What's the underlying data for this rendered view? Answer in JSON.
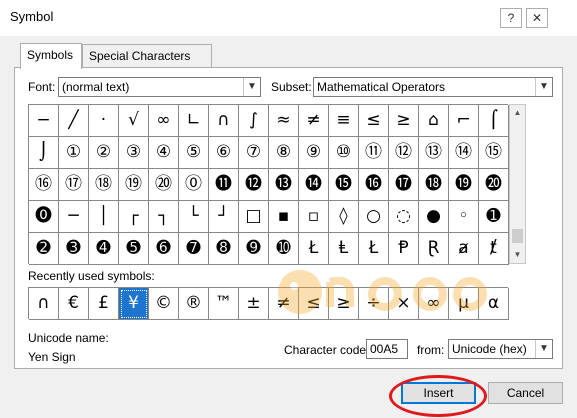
{
  "window": {
    "title": "Symbol",
    "help_glyph": "?",
    "close_glyph": "✕"
  },
  "tabs": [
    {
      "label": "Symbols",
      "active": true
    },
    {
      "label": "Special Characters",
      "active": false
    }
  ],
  "font_label": "Font:",
  "font_value": "(normal text)",
  "subset_label": "Subset:",
  "subset_value": "Mathematical Operators",
  "grid": {
    "columns": 16,
    "rows": [
      [
        "−",
        "╱",
        "·",
        "√",
        "∞",
        "∟",
        "∩",
        "∫",
        "≈",
        "≠",
        "≡",
        "≤",
        "≥",
        "⌂",
        "⌐",
        "⌠"
      ],
      [
        "⌡",
        "①",
        "②",
        "③",
        "④",
        "⑤",
        "⑥",
        "⑦",
        "⑧",
        "⑨",
        "⑩",
        "⑪",
        "⑫",
        "⑬",
        "⑭",
        "⑮"
      ],
      [
        "⑯",
        "⑰",
        "⑱",
        "⑲",
        "⑳",
        "⓪",
        "⓫",
        "⓬",
        "⓭",
        "⓮",
        "⓯",
        "⓰",
        "⓱",
        "⓲",
        "⓳",
        "⓴"
      ],
      [
        "⓿",
        "─",
        "│",
        "┌",
        "┐",
        "└",
        "┘",
        "□",
        "▪",
        "▫",
        "◊",
        "○",
        "◌",
        "●",
        "◦",
        "➊"
      ],
      [
        "➋",
        "➌",
        "➍",
        "➎",
        "➏",
        "➐",
        "➑",
        "➒",
        "➓",
        "Ł",
        "Ⱡ",
        "Ł",
        "Ᵽ",
        "Ɽ",
        "ⱥ",
        "ⱦ"
      ]
    ]
  },
  "recent_label": "Recently used symbols:",
  "recent_symbols": [
    "∩",
    "€",
    "£",
    "¥",
    "©",
    "®",
    "™",
    "±",
    "≠",
    "≤",
    "≥",
    "÷",
    "×",
    "∞",
    "µ",
    "α"
  ],
  "recent_selected_index": 3,
  "unicode_name_label": "Unicode name:",
  "unicode_name_value": "Yen Sign",
  "char_code_label": "Character code:",
  "char_code_value": "00A5",
  "from_label": "from:",
  "from_value": "Unicode (hex)",
  "buttons": {
    "insert": "Insert",
    "cancel": "Cancel"
  },
  "icons": {
    "dropdown": "chevron-down-icon",
    "scroll_up": "scroll-up-icon",
    "scroll_down": "scroll-down-icon"
  },
  "colors": {
    "selected": "#1e75d0",
    "highlight_circle": "#e0191b",
    "dialog_bg": "#f0f0f0"
  }
}
